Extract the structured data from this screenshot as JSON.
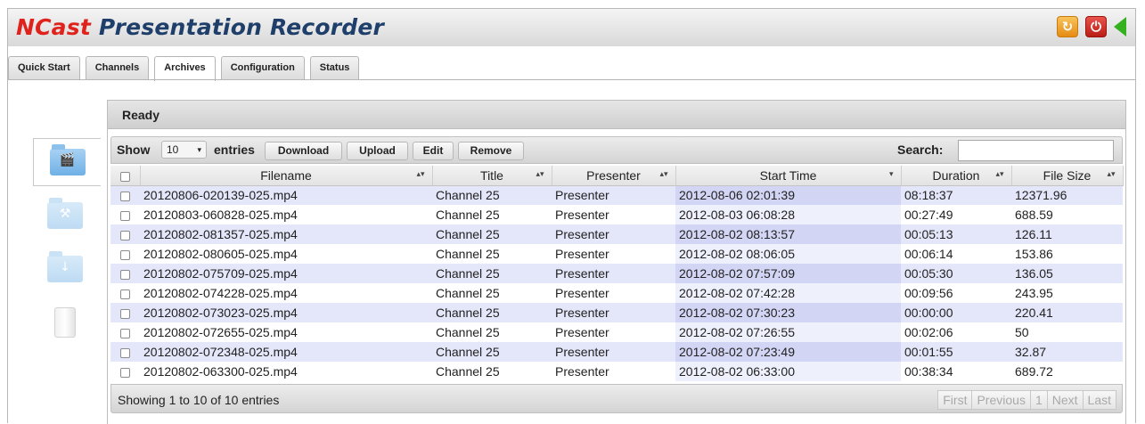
{
  "app": {
    "title_brand": "NCast",
    "title_rest": " Presentation Recorder"
  },
  "header_icons": [
    "refresh-icon",
    "power-icon",
    "back-arrow-icon"
  ],
  "tabs": [
    {
      "label": "Quick Start",
      "active": false
    },
    {
      "label": "Channels",
      "active": false
    },
    {
      "label": "Archives",
      "active": true
    },
    {
      "label": "Configuration",
      "active": false
    },
    {
      "label": "Status",
      "active": false
    }
  ],
  "side_icons": [
    "archive-folder-icon",
    "tools-folder-icon",
    "download-folder-icon",
    "trash-icon"
  ],
  "panel": {
    "status": "Ready"
  },
  "toolbar": {
    "show_label": "Show",
    "page_size": "10",
    "entries_label": "entries",
    "download_label": "Download",
    "upload_label": "Upload",
    "edit_label": "Edit",
    "remove_label": "Remove",
    "search_label": "Search:",
    "search_value": ""
  },
  "table": {
    "columns": [
      "Filename",
      "Title",
      "Presenter",
      "Start Time",
      "Duration",
      "File Size"
    ],
    "sorted_column": "Start Time",
    "rows": [
      {
        "filename": "20120806-020139-025.mp4",
        "title": "Channel 25",
        "presenter": "Presenter",
        "start": "2012-08-06 02:01:39",
        "duration": "08:18:37",
        "size": "12371.96"
      },
      {
        "filename": "20120803-060828-025.mp4",
        "title": "Channel 25",
        "presenter": "Presenter",
        "start": "2012-08-03 06:08:28",
        "duration": "00:27:49",
        "size": "688.59"
      },
      {
        "filename": "20120802-081357-025.mp4",
        "title": "Channel 25",
        "presenter": "Presenter",
        "start": "2012-08-02 08:13:57",
        "duration": "00:05:13",
        "size": "126.11"
      },
      {
        "filename": "20120802-080605-025.mp4",
        "title": "Channel 25",
        "presenter": "Presenter",
        "start": "2012-08-02 08:06:05",
        "duration": "00:06:14",
        "size": "153.86"
      },
      {
        "filename": "20120802-075709-025.mp4",
        "title": "Channel 25",
        "presenter": "Presenter",
        "start": "2012-08-02 07:57:09",
        "duration": "00:05:30",
        "size": "136.05"
      },
      {
        "filename": "20120802-074228-025.mp4",
        "title": "Channel 25",
        "presenter": "Presenter",
        "start": "2012-08-02 07:42:28",
        "duration": "00:09:56",
        "size": "243.95"
      },
      {
        "filename": "20120802-073023-025.mp4",
        "title": "Channel 25",
        "presenter": "Presenter",
        "start": "2012-08-02 07:30:23",
        "duration": "00:00:00",
        "size": "220.41"
      },
      {
        "filename": "20120802-072655-025.mp4",
        "title": "Channel 25",
        "presenter": "Presenter",
        "start": "2012-08-02 07:26:55",
        "duration": "00:02:06",
        "size": "50"
      },
      {
        "filename": "20120802-072348-025.mp4",
        "title": "Channel 25",
        "presenter": "Presenter",
        "start": "2012-08-02 07:23:49",
        "duration": "00:01:55",
        "size": "32.87"
      },
      {
        "filename": "20120802-063300-025.mp4",
        "title": "Channel 25",
        "presenter": "Presenter",
        "start": "2012-08-02 06:33:00",
        "duration": "00:38:34",
        "size": "689.72"
      }
    ]
  },
  "footer": {
    "info": "Showing 1 to 10 of 10 entries",
    "pager": {
      "first": "First",
      "previous": "Previous",
      "page": "1",
      "next": "Next",
      "last": "Last"
    }
  }
}
